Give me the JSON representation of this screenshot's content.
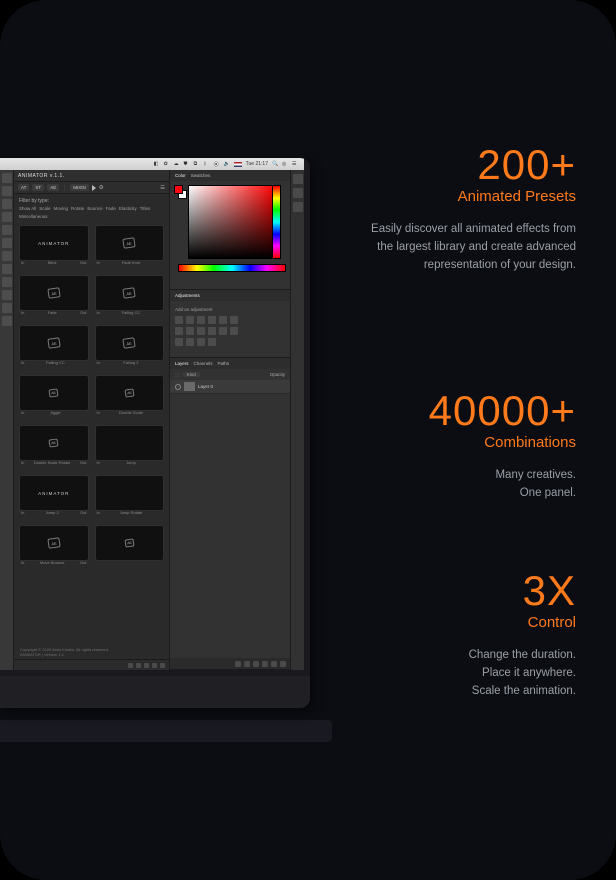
{
  "menubar": {
    "time_label": "Tue 21:17"
  },
  "promo": [
    {
      "big": "200+",
      "sub": "Animated Presets",
      "desc": "Easily discover all animated effects from the largest library and create advanced representation of your design."
    },
    {
      "big": "40000+",
      "sub": "Combinations",
      "desc": "Many creatives.\nOne panel."
    },
    {
      "big": "3X",
      "sub": "Control",
      "desc": "Change the duration.\nPlace it anywhere.\nScale the animation."
    }
  ],
  "animator": {
    "title": "ANIMATOR v.1.1.",
    "toolbar": {
      "at": "AT",
      "st": "ST",
      "ae": "AE",
      "mixin": "MIXIN"
    },
    "filter_label": "Filter by type:",
    "filter_tags": [
      "Show All",
      "Scale",
      "Moving",
      "Rotate",
      "Bounce",
      "Fade",
      "Elasticity",
      "Titles",
      "Miscellaneous"
    ],
    "presets": [
      {
        "label": "Blink",
        "in": "In",
        "out": "Out",
        "thumb_text": "ANIMATOR"
      },
      {
        "label": "Fade from",
        "in": "In",
        "thumb_icon": "ae"
      },
      {
        "label": "Fade",
        "in": "In",
        "out": "Out",
        "thumb_icon": "ae"
      },
      {
        "label": "Falling CC",
        "in": "In",
        "thumb_icon": "ae"
      },
      {
        "label": "Falling CC",
        "in": "In",
        "thumb_icon": "ae"
      },
      {
        "label": "Falling 2",
        "in": "In",
        "thumb_icon": "ae"
      },
      {
        "label": "Jiggle",
        "in": "In",
        "thumb_icon": "ae-sm"
      },
      {
        "label": "Double Scale",
        "in": "In",
        "thumb_icon": "ae-sm"
      },
      {
        "label": "Double Scale Rotate",
        "in": "In",
        "out": "Out",
        "thumb_icon": "ae-sm"
      },
      {
        "label": "Jump",
        "in": "In",
        "thumb_icon": "none"
      },
      {
        "label": "Jump 2",
        "in": "In",
        "out": "Out",
        "thumb_text": "ANIMATOR"
      },
      {
        "label": "Jump Rotate",
        "in": "In",
        "thumb_icon": "none"
      },
      {
        "label": "Move Bounce",
        "in": "In",
        "out": "Out",
        "thumb_icon": "ae"
      },
      {
        "label": "",
        "in": "",
        "thumb_icon": "ae-sm"
      }
    ],
    "copyright": "Copyright © 2020 Andy Kostiw. All rights reserved.",
    "version_mark": "ANIMATOR | Version 1.1"
  },
  "ps_panels": {
    "color_tabs": [
      "Color",
      "Swatches"
    ],
    "adjustments_tab": "Adjustments",
    "adjustments_hint": "Add an adjustment",
    "layers_tabs": [
      "Layers",
      "Channels",
      "Paths"
    ],
    "layer_kind": "Kind",
    "layer_opacity": "Opacity",
    "layer_name": "Layer 0"
  }
}
